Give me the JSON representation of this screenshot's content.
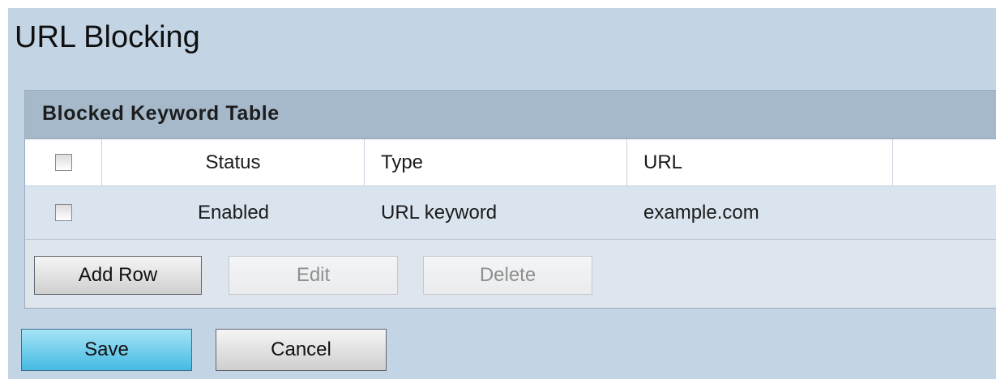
{
  "page": {
    "title": "URL Blocking"
  },
  "table": {
    "caption": "Blocked Keyword Table",
    "columns": [
      "",
      "Status",
      "Type",
      "URL",
      ""
    ],
    "rows": [
      {
        "checked": false,
        "status": "Enabled",
        "type": "URL keyword",
        "url": "example.com"
      }
    ],
    "buttons": {
      "add": "Add Row",
      "edit": "Edit",
      "delete": "Delete"
    }
  },
  "footer": {
    "save": "Save",
    "cancel": "Cancel"
  },
  "colors": {
    "panel_background": "#c3d4e5",
    "caption_background": "#a5b9cb",
    "row_background": "#d9e4ef",
    "save_accent": "#44bbe2"
  }
}
